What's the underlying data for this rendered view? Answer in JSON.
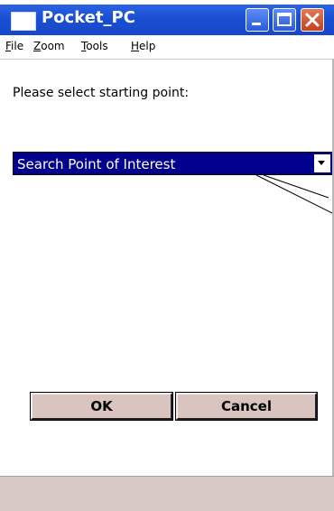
{
  "window": {
    "title": "Pocket_PC"
  },
  "menubar": [
    {
      "accel": "F",
      "rest": "ile"
    },
    {
      "accel": "Z",
      "rest": "oom"
    },
    {
      "accel": "T",
      "rest": "ools"
    },
    {
      "accel": "H",
      "rest": "elp"
    }
  ],
  "prompt": "Please select starting point:",
  "dropdown": {
    "selected": "Search Point of Interest"
  },
  "buttons": {
    "ok": "OK",
    "cancel": "Cancel"
  },
  "colors": {
    "titlebar": "#1a4fd2",
    "dropdown_highlight": "#01018e",
    "button_face": "#d9c4c0",
    "bottom_bar": "#d8c8c4"
  },
  "icons": [
    "app-icon",
    "minimize-icon",
    "maximize-icon",
    "close-icon",
    "chevron-down-icon"
  ]
}
